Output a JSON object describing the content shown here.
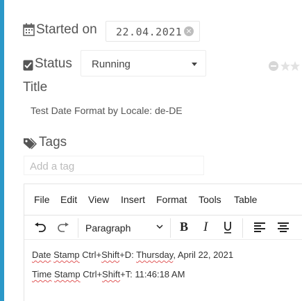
{
  "accent_color": "#2b98c8",
  "started": {
    "label": "Started on",
    "date": "22.04.2021",
    "clear_icon": "circle-x-icon"
  },
  "status": {
    "label": "Status",
    "value": "Running"
  },
  "title": {
    "label": "Title",
    "value": "Test Date Format by Locale: de-DE"
  },
  "tags": {
    "label": "Tags",
    "placeholder": "Add a tag"
  },
  "editor": {
    "menu": [
      "File",
      "Edit",
      "View",
      "Insert",
      "Format",
      "Tools",
      "Table"
    ],
    "toolbar": {
      "format_select": "Paragraph",
      "bold": "B",
      "italic": "I",
      "underline": "U"
    },
    "lines": [
      {
        "words": [
          "Date",
          "Stamp"
        ],
        "shortcut_prefix": "Ctrl+",
        "shortcut_mid": "Shift",
        "shortcut_suffix": "+D: ",
        "day": "Thursday",
        "rest": ", April 22, 2021"
      },
      {
        "words": [
          "Time",
          "Stamp"
        ],
        "shortcut_prefix": "Ctrl+",
        "shortcut_mid": "Shift",
        "shortcut_suffix": "+T: ",
        "rest": "11:46:18 AM"
      }
    ]
  }
}
